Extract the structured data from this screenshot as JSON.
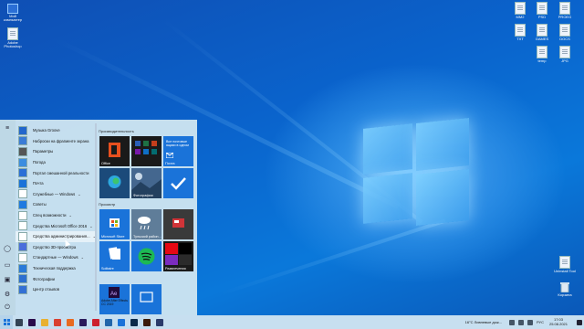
{
  "desktop": {
    "icons_left": [
      {
        "label": "Мой компьютер",
        "type": "pc"
      },
      {
        "label": "Adobe Photoshop",
        "type": "doc"
      }
    ],
    "icons_right": [
      {
        "label": "MM2",
        "type": "doc"
      },
      {
        "label": "PSD",
        "type": "doc"
      },
      {
        "label": "PROEG",
        "type": "doc"
      },
      {
        "label": "TXT",
        "type": "doc"
      },
      {
        "label": "GAMES",
        "type": "doc"
      },
      {
        "label": "DOCS",
        "type": "doc"
      },
      {
        "label": "temp",
        "type": "doc"
      },
      {
        "label": "JPG",
        "type": "doc"
      },
      {
        "label": "Uninstall Tool",
        "type": "doc"
      },
      {
        "label": "Корзина",
        "type": "bin"
      }
    ]
  },
  "start_menu": {
    "rail_icons": [
      "hamburger-icon",
      "user-icon",
      "documents-icon",
      "pictures-icon",
      "settings-icon",
      "power-icon"
    ],
    "apps": [
      {
        "label": "Музыка Groove",
        "color": "#2266cc"
      },
      {
        "label": "Наброски на фрагменте экрана",
        "color": "#3a7bd5"
      },
      {
        "label": "Параметры",
        "color": "#555555"
      },
      {
        "label": "Погода",
        "color": "#3b8de0"
      },
      {
        "label": "Портал смешанной реальности",
        "color": "#2a6fd6"
      },
      {
        "label": "Почта",
        "color": "#1a73d9"
      },
      {
        "label": "Служебные — Windows",
        "color": "#ffffff",
        "folder": true
      },
      {
        "label": "Советы",
        "color": "#1f7ae0"
      },
      {
        "label": "Спец возможности",
        "color": "#ffffff",
        "folder": true
      },
      {
        "label": "Средства Microsoft Office 2016",
        "color": "#ffffff",
        "folder": true
      },
      {
        "label": "Средства администрирования...",
        "color": "#ffffff",
        "folder": true,
        "highlight": true
      },
      {
        "label": "Средство 3D-просмотра",
        "color": "#4a6edb"
      },
      {
        "label": "Стандартные — Windows",
        "color": "#ffffff",
        "folder": true
      },
      {
        "label": "Техническая поддержка",
        "color": "#2a7ad8"
      },
      {
        "label": "Фотографии",
        "color": "#2b6fd0"
      },
      {
        "label": "Центр отзывов",
        "color": "#3370d4"
      }
    ],
    "groups": {
      "productivity": "Производительность",
      "browse": "Просмотр"
    },
    "tiles": {
      "office": "Office",
      "mail_text": "Все почтовые ящики в одном",
      "mail": "Почта",
      "edge": "",
      "photos": "Фотографии",
      "todo": "",
      "store": "Microsoft Store",
      "weather": "Тульский район...",
      "news": "",
      "solitaire": "Solitaire",
      "spotify": "",
      "entertainment": "Развлечения",
      "ae": "Adobe After Effects CC 2019"
    }
  },
  "taskbar": {
    "apps": [
      {
        "name": "task-view-icon",
        "color": "#334455"
      },
      {
        "name": "premiere-icon",
        "color": "#2a0a4a"
      },
      {
        "name": "explorer-icon",
        "color": "#e8b030"
      },
      {
        "name": "chrome-icon",
        "color": "#d94030"
      },
      {
        "name": "firefox-icon",
        "color": "#e86a20"
      },
      {
        "name": "aftereffects-icon",
        "color": "#2a1a5a"
      },
      {
        "name": "opera-icon",
        "color": "#cc1f2d"
      },
      {
        "name": "files-icon",
        "color": "#2266aa"
      },
      {
        "name": "mail-icon",
        "color": "#1a73d9"
      },
      {
        "name": "photoshop-icon",
        "color": "#0a2a4a"
      },
      {
        "name": "illustrator-icon",
        "color": "#3a1a0a"
      },
      {
        "name": "media-icon",
        "color": "#2a3a6a"
      }
    ],
    "weather": "16°C  Ливневые дож...",
    "lang": "РУС",
    "time": "17:03",
    "date": "25.08.2021"
  }
}
